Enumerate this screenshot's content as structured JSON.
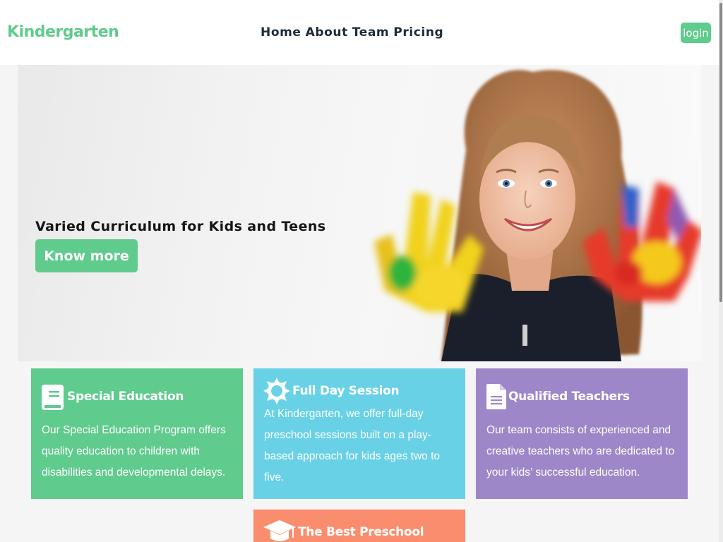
{
  "header": {
    "brand": "Kindergarten",
    "nav": [
      {
        "label": "Home"
      },
      {
        "label": "About"
      },
      {
        "label": "Team"
      },
      {
        "label": "Pricing"
      }
    ],
    "login_label": "login"
  },
  "hero": {
    "title": "Varied Curriculum for Kids and Teens",
    "button_label": "Know more",
    "image": "photo of smiling girl with paint-covered hands"
  },
  "cards": [
    {
      "icon": "book-icon",
      "title": "Special Education",
      "body": "Our Special Education Program offers quality education to children with disabilities and developmental delays.",
      "color": "#5fcb8c"
    },
    {
      "icon": "sun-icon",
      "title": "Full Day Session",
      "body": "At Kindergarten, we offer full-day preschool sessions built on a play-based approach for kids ages two to five.",
      "color": "#68d1e6"
    },
    {
      "icon": "document-icon",
      "title": "Qualified Teachers",
      "body": "Our team consists of experienced and creative teachers who are dedicated to your kids’ successful education.",
      "color": "#9e87c8"
    },
    {
      "icon": "graduation-cap-icon",
      "title": "The Best Preschool",
      "body": "",
      "color": "#fa8d6d"
    }
  ],
  "colors": {
    "accent": "#5fcb8c",
    "nav_text": "#1e2a36",
    "page_bg": "#f5f5f5"
  }
}
